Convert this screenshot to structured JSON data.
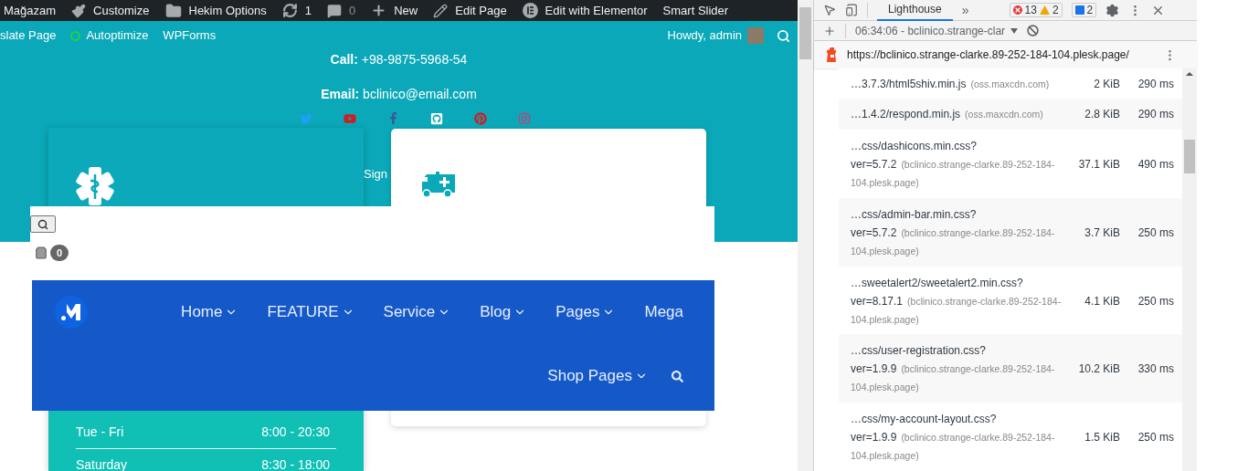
{
  "admin_bar": {
    "items": [
      {
        "label": "Mağazam",
        "dimmed": false
      },
      {
        "label": "Customize",
        "dimmed": false
      },
      {
        "label": "Hekim Options",
        "dimmed": false
      },
      {
        "label": "1",
        "dimmed": false
      },
      {
        "label": "0",
        "dimmed": true
      },
      {
        "label": "New",
        "dimmed": false
      },
      {
        "label": "Edit Page",
        "dimmed": false
      },
      {
        "label": "Edit with Elementor",
        "dimmed": false
      },
      {
        "label": "Smart Slider",
        "dimmed": false
      }
    ],
    "second_row": [
      "slate Page",
      "Autoptimize",
      "WPForms"
    ],
    "greeting": "Howdy, admin"
  },
  "contact": {
    "lines": [
      "**Call:** +98-9875-5968-54",
      "**Email:** bclinico@email.com"
    ]
  },
  "sign_text": "Sign",
  "cart": {
    "count": "0"
  },
  "nav": {
    "items": [
      {
        "label": "Home",
        "has_dropdown": true
      },
      {
        "label": "FEATURE",
        "has_dropdown": true
      },
      {
        "label": "Service",
        "has_dropdown": true
      },
      {
        "label": "Blog",
        "has_dropdown": true
      },
      {
        "label": "Pages",
        "has_dropdown": true
      },
      {
        "label": "Mega",
        "has_dropdown": false
      },
      {
        "label": "Shop Pages",
        "has_dropdown": true
      }
    ]
  },
  "hours": [
    {
      "days": "Tue - Fri",
      "time": "8:00 - 20:30"
    },
    {
      "days": "Saturday",
      "time": "8:30 - 18:00"
    }
  ],
  "devtools": {
    "tabs": [
      {
        "label": "Lighthouse",
        "selected": true
      }
    ],
    "more": "»",
    "errors": "13",
    "warnings": "2",
    "messages": "2",
    "report": "06:34:06 - bclinico.strange-clar",
    "url": "https://bclinico.strange-clarke.89-252-184-104.plesk.page/",
    "rows": [
      {
        "path": "…3.7.3/html5shiv.min.js",
        "query": "",
        "host": "(oss.maxcdn.com)",
        "size": "2 KiB",
        "time": "290 ms"
      },
      {
        "path": "…1.4.2/respond.min.js",
        "query": "",
        "host": "(oss.maxcdn.com)",
        "size": "2.8 KiB",
        "time": "290 ms"
      },
      {
        "path": "…css/dashicons.min.css?",
        "query": "ver=5.7.2",
        "host": "(bclinico.strange-clarke.89-252-184-104.plesk.page)",
        "size": "37.1 KiB",
        "time": "490 ms"
      },
      {
        "path": "…css/admin-bar.min.css?",
        "query": "ver=5.7.2",
        "host": "(bclinico.strange-clarke.89-252-184-104.plesk.page)",
        "size": "3.7 KiB",
        "time": "250 ms"
      },
      {
        "path": "…sweetalert2/sweetalert2.min.css?",
        "query": "ver=8.17.1",
        "host": "(bclinico.strange-clarke.89-252-184-104.plesk.page)",
        "size": "4.1 KiB",
        "time": "250 ms"
      },
      {
        "path": "…css/user-registration.css?",
        "query": "ver=1.9.9",
        "host": "(bclinico.strange-clarke.89-252-184-104.plesk.page)",
        "size": "10.2 KiB",
        "time": "330 ms"
      },
      {
        "path": "…css/my-account-layout.css?",
        "query": "ver=1.9.9",
        "host": "(bclinico.strange-clarke.89-252-184-104.plesk.page)",
        "size": "1.5 KiB",
        "time": "250 ms"
      }
    ]
  }
}
